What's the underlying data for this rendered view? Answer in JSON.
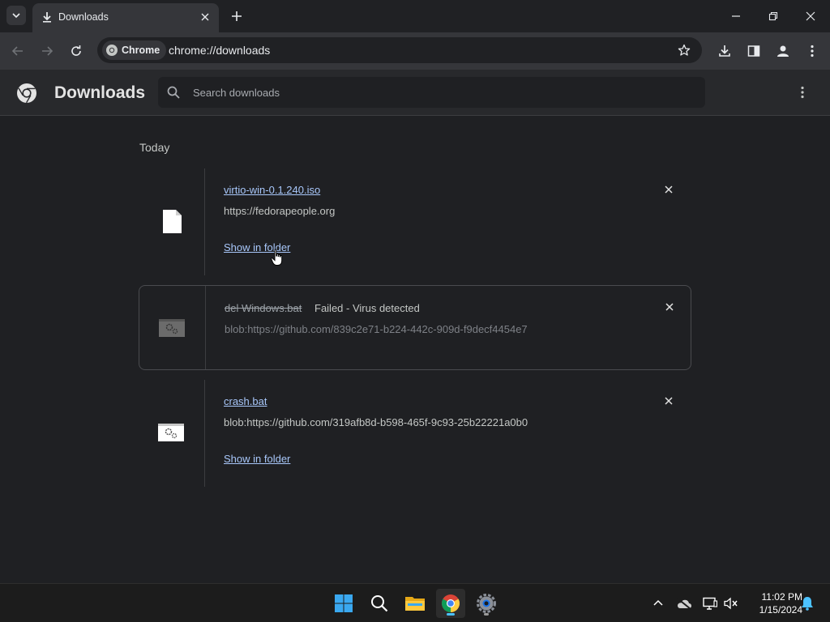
{
  "browser": {
    "tab": {
      "title": "Downloads"
    },
    "chip_label": "Chrome",
    "url": "chrome://downloads"
  },
  "downloads_page": {
    "title": "Downloads",
    "search_placeholder": "Search downloads",
    "section_label": "Today",
    "items": [
      {
        "filename": "virtio-win-0.1.240.iso",
        "url": "https://fedorapeople.org",
        "action": "Show in folder",
        "status": ""
      },
      {
        "filename": "del Windows.bat",
        "status": "Failed - Virus detected",
        "url": "blob:https://github.com/839c2e71-b224-442c-909d-f9decf4454e7"
      },
      {
        "filename": "crash.bat",
        "url": "blob:https://github.com/319afb8d-b598-465f-9c93-25b22221a0b0",
        "action": "Show in folder",
        "status": ""
      }
    ]
  },
  "taskbar": {
    "apps": [
      "start-icon",
      "search-icon",
      "file-explorer-icon",
      "chrome-icon",
      "settings-icon"
    ],
    "time": "11:02 PM",
    "date": "1/15/2024"
  },
  "colors": {
    "link": "#a8c7fa",
    "background": "#1f2023",
    "taskbar_accent": "#4cc2ff"
  }
}
